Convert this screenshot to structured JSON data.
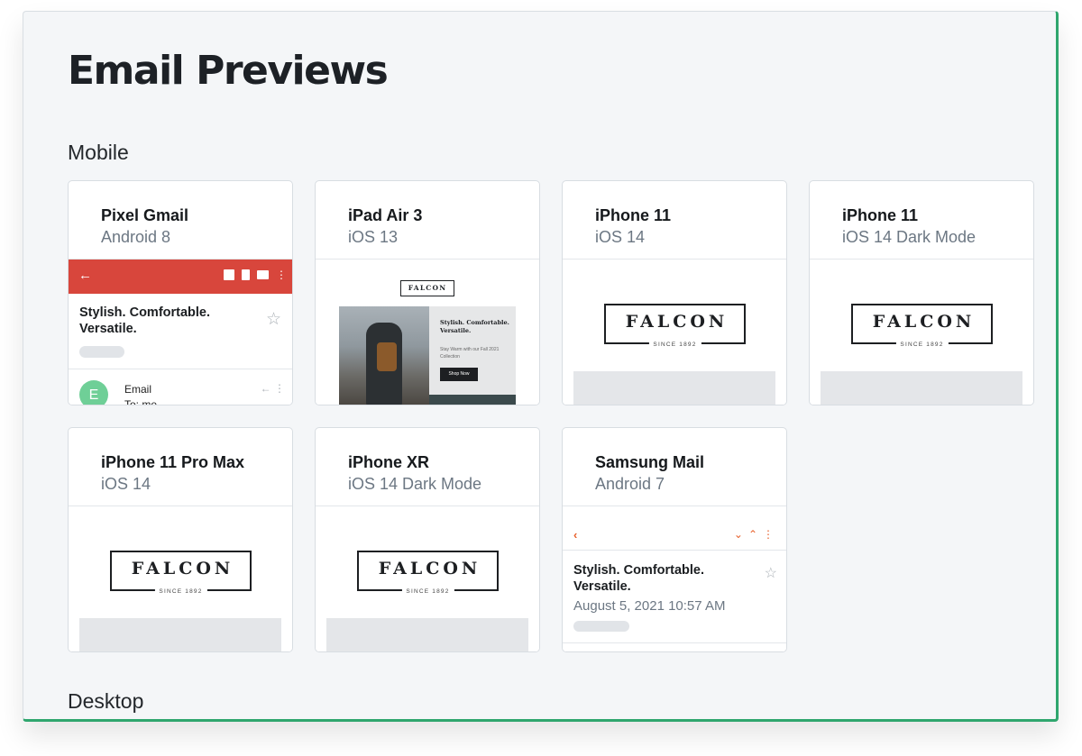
{
  "page": {
    "title": "Email Previews"
  },
  "sections": {
    "mobile": "Mobile",
    "desktop": "Desktop"
  },
  "colors": {
    "accent": "#2fa66e",
    "gmail_bar": "#d8463c",
    "samsung_accent": "#e8612c"
  },
  "cards": [
    {
      "name": "Pixel Gmail",
      "os": "Android 8"
    },
    {
      "name": "iPad Air 3",
      "os": "iOS 13"
    },
    {
      "name": "iPhone 11",
      "os": "iOS 14"
    },
    {
      "name": "iPhone 11",
      "os": "iOS 14 Dark Mode"
    },
    {
      "name": "iPhone 11 Pro Max",
      "os": "iOS 14"
    },
    {
      "name": "iPhone XR",
      "os": "iOS 14 Dark Mode"
    },
    {
      "name": "Samsung Mail",
      "os": "Android 7"
    }
  ],
  "brand": {
    "logo": "FALCON",
    "since": "SINCE 1892"
  },
  "gmail_preview": {
    "icons": [
      "back-arrow-icon",
      "archive-icon",
      "trash-icon",
      "mail-icon",
      "more-icon"
    ],
    "subject": "Stylish. Comfortable. Versatile.",
    "avatar_letter": "E",
    "sender": "Email",
    "sender_line2": "To: me"
  },
  "ipad_preview": {
    "logo": "FALCON",
    "headline": "Stylish. Comfortable. Versatile.",
    "sub": "Stay Warm with our Fall 2021 Collection",
    "button": "Shop Now"
  },
  "samsung_preview": {
    "icons": [
      "back-icon",
      "chevron-down-icon",
      "chevron-up-icon",
      "more-icon"
    ],
    "subject": "Stylish. Comfortable. Versatile.",
    "date": "August 5, 2021 10:57 AM"
  }
}
